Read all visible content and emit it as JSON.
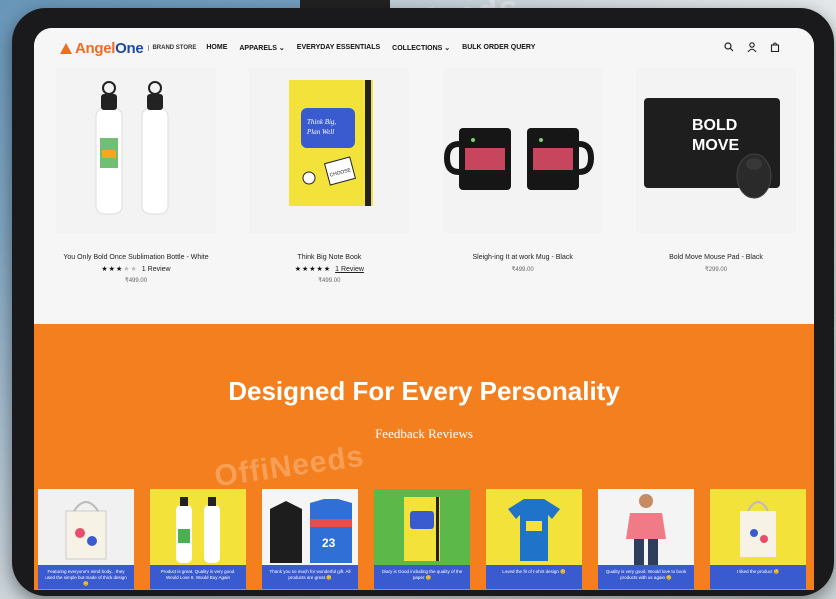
{
  "brand": {
    "name_a": "Angel",
    "name_b": "One",
    "sub": "BRAND STORE"
  },
  "nav": [
    "HOME",
    "APPARELS ⌄",
    "EVERYDAY ESSENTIALS",
    "COLLECTIONS ⌄",
    "BULK ORDER QUERY"
  ],
  "header_icons": [
    "search-icon",
    "user-icon",
    "bag-icon"
  ],
  "watermark": "OffiNeeds",
  "products": [
    {
      "name": "You Only Bold Once Sublimation Bottle - White",
      "stars": 3,
      "review": "1 Review",
      "price": "₹499.00"
    },
    {
      "name": "Think Big Note Book",
      "stars": 5,
      "review": "1 Review",
      "price": "₹499.00"
    },
    {
      "name": "Sleigh-ing It at work Mug - Black",
      "stars": 0,
      "review": "",
      "price": "₹499.00"
    },
    {
      "name": "Bold Move Mouse Pad - Black",
      "stars": 0,
      "review": "",
      "price": "₹299.00"
    }
  ],
  "section": {
    "title": "Designed For Every Personality",
    "subtitle": "Feedback Reviews"
  },
  "reviews": [
    {
      "text": "Featuring everyone's mind body... they used the simple but made of thick design 😊"
    },
    {
      "text": "Product is great. Quality is very good. Would Love It. Would Buy Again"
    },
    {
      "text": "Thank you so much for wonderful gift. All products are great 😊"
    },
    {
      "text": "Diary is Good including the quality of the paper 😊"
    },
    {
      "text": "Loved the fit of t-shirt design 😊"
    },
    {
      "text": "Quality is very good. Would love to book products with us again 😊"
    },
    {
      "text": "I liked the product 😊"
    }
  ],
  "colors": {
    "orange": "#f47f1e",
    "blue": "#3a5bd0",
    "brand_orange": "#f26b21",
    "brand_blue": "#1e4aa0"
  }
}
